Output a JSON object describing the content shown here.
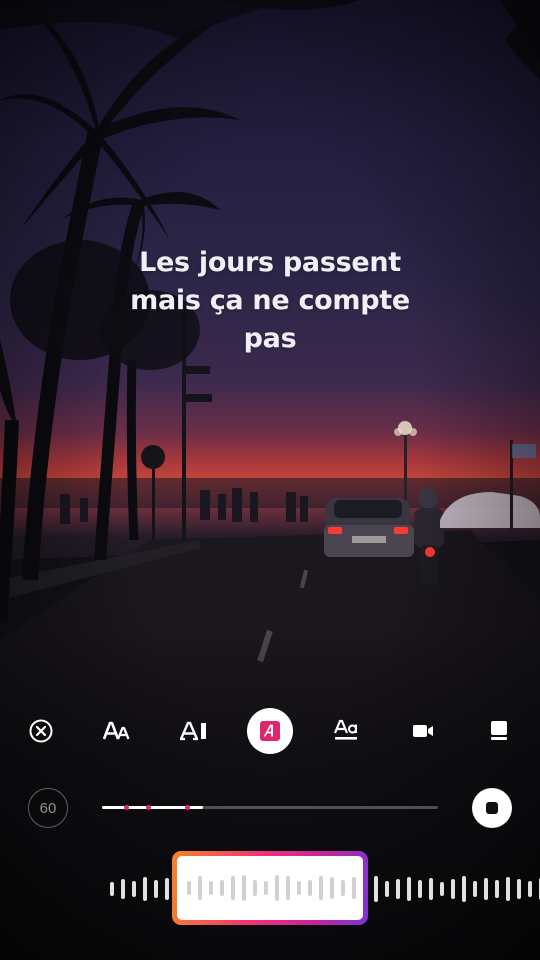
{
  "lyrics": {
    "line1": "Les jours passent",
    "line2": "mais ça ne compte",
    "line3": "pas"
  },
  "toolbar": {
    "tools": [
      {
        "name": "close",
        "icon": "close-circle-icon"
      },
      {
        "name": "font-size",
        "icon": "font-size-icon"
      },
      {
        "name": "typewriter",
        "icon": "text-cursor-icon"
      },
      {
        "name": "highlight",
        "icon": "text-highlight-icon",
        "active": true
      },
      {
        "name": "underline",
        "icon": "text-underline-icon"
      },
      {
        "name": "video",
        "icon": "video-frame-icon"
      },
      {
        "name": "card",
        "icon": "card-icon"
      }
    ]
  },
  "duration": {
    "seconds": "60"
  },
  "playback": {
    "progress": 0.3
  },
  "colors": {
    "accent_pink": "#e0246e",
    "gradient_start": "#f58529",
    "gradient_end": "#7a34d6"
  }
}
